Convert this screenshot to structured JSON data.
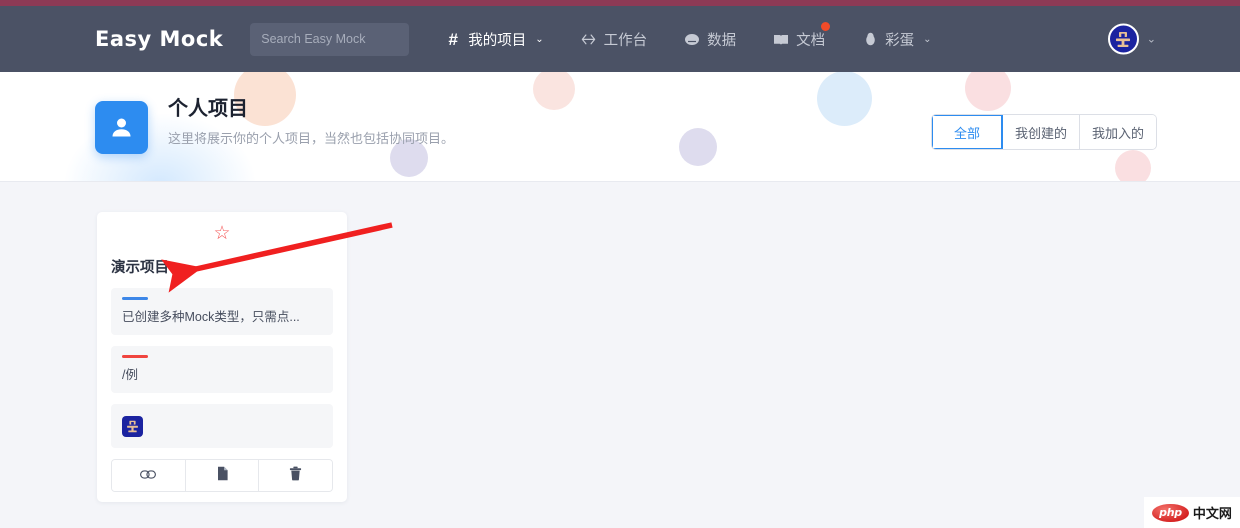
{
  "theme": {
    "accent_bar": "#8d3a55",
    "header_bg": "#4b5265",
    "primary_blue": "#2d8cf0",
    "page_bg": "#f4f5f9",
    "badge_red": "#f04b29",
    "star_red": "#f45a5a",
    "annotation_red": "#f02020"
  },
  "header": {
    "brand": "Easy Mock",
    "search": {
      "value": "",
      "placeholder": "Search Easy Mock"
    },
    "nav": [
      {
        "icon": "hash-icon",
        "label": "我的项目",
        "caret": "⌄",
        "active": true,
        "badge": false
      },
      {
        "icon": "code-arrows-icon",
        "label": "工作台",
        "caret": "",
        "active": false,
        "badge": false
      },
      {
        "icon": "database-icon",
        "label": "数据",
        "caret": "",
        "active": false,
        "badge": false
      },
      {
        "icon": "book-icon",
        "label": "文档",
        "caret": "",
        "active": false,
        "badge": true
      },
      {
        "icon": "egg-icon",
        "label": "彩蛋",
        "caret": "⌄",
        "active": false,
        "badge": false
      }
    ],
    "avatar": {
      "icon": "user-avatar-icon",
      "caret": "⌄"
    }
  },
  "hero": {
    "icon": "person-icon",
    "title": "个人项目",
    "subtitle": "这里将展示你的个人项目，当然也包括协同项目。",
    "filters": [
      {
        "label": "全部",
        "active": true
      },
      {
        "label": "我创建的",
        "active": false
      },
      {
        "label": "我加入的",
        "active": false
      }
    ]
  },
  "project_card": {
    "star_icon": "☆",
    "title": "演示项目",
    "rows": [
      {
        "bar_color": "blue",
        "text": "已创建多种Mock类型，只需点..."
      },
      {
        "bar_color": "red",
        "text": "/例"
      }
    ],
    "member_avatar_icon": "user-avatar-icon",
    "actions": [
      {
        "icon": "link-icon",
        "name": "copy-link-button"
      },
      {
        "icon": "copy-icon",
        "name": "clone-project-button"
      },
      {
        "icon": "trash-icon",
        "name": "delete-project-button"
      }
    ]
  },
  "watermark": {
    "logo": "php",
    "text": "中文网"
  }
}
